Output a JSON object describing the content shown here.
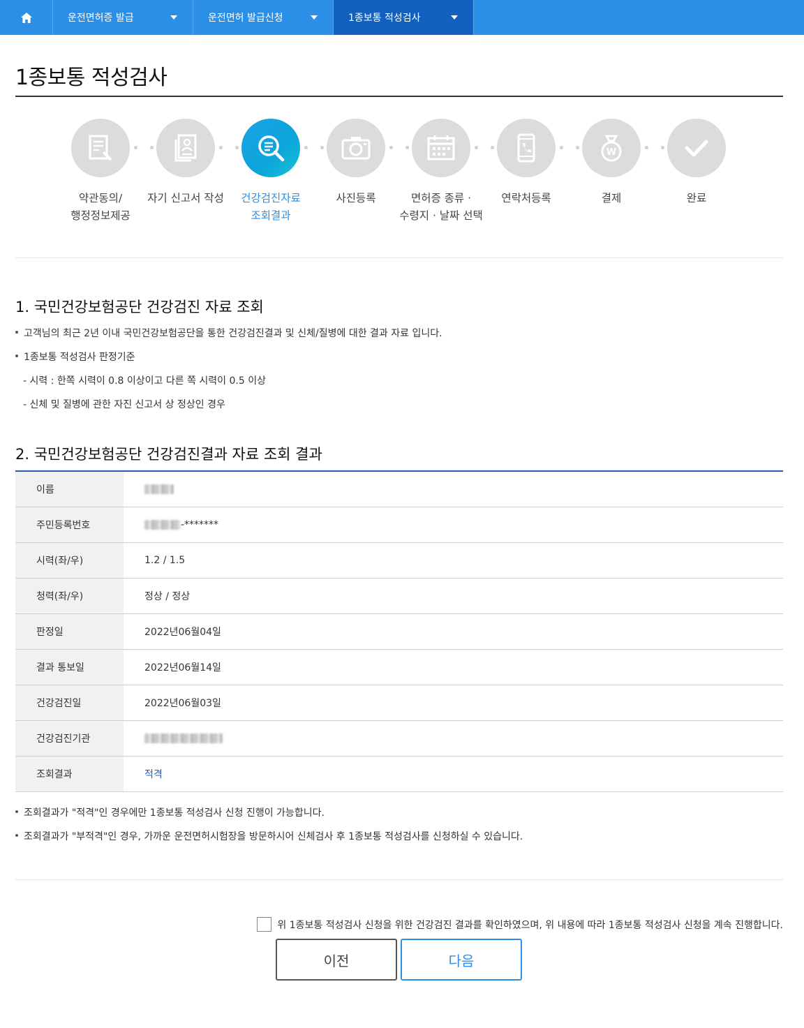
{
  "nav": {
    "items": [
      {
        "label": "운전면허증 발급"
      },
      {
        "label": "운전면허 발급신청"
      },
      {
        "label": "1종보통 적성검사"
      }
    ]
  },
  "page": {
    "title": "1종보통 적성검사"
  },
  "steps": [
    {
      "label": "약관동의/\n행정정보제공",
      "icon": "document-edit-icon"
    },
    {
      "label": "자기 신고서 작성",
      "icon": "self-report-icon"
    },
    {
      "label": "건강검진자료\n조회결과",
      "icon": "search-list-icon",
      "active": true
    },
    {
      "label": "사진등록",
      "icon": "camera-icon"
    },
    {
      "label": "면허증 종류 ·\n수령지 · 날짜 선택",
      "icon": "calendar-icon"
    },
    {
      "label": "연락처등록",
      "icon": "phone-icon"
    },
    {
      "label": "결제",
      "icon": "money-bag-icon"
    },
    {
      "label": "완료",
      "icon": "check-icon"
    }
  ],
  "section1": {
    "title": "1. 국민건강보험공단 건강검진 자료 조회",
    "bullet1": "고객님의 최근 2년 이내 국민건강보험공단을 통한 건강검진결과 및 신체/질병에 대한 결과 자료 입니다.",
    "bullet2": "1종보통 적성검사 판정기준",
    "sub1": "- 시력 : 한쪽 시력이 0.8 이상이고 다른 쪽 시력이 0.5 이상",
    "sub2": "- 신체 및 질병에 관한 자진 신고서 상 정상인 경우"
  },
  "section2": {
    "title": "2. 국민건강보험공단 건강검진결과 자료 조회 결과",
    "rows": [
      {
        "label": "이름",
        "value": ""
      },
      {
        "label": "주민등록번호",
        "value": "-*******"
      },
      {
        "label": "시력(좌/우)",
        "value": "1.2 / 1.5"
      },
      {
        "label": "청력(좌/우)",
        "value": "정상 / 정상"
      },
      {
        "label": "판정일",
        "value": "2022년06월04일"
      },
      {
        "label": "결과 통보일",
        "value": "2022년06월14일"
      },
      {
        "label": "건강검진일",
        "value": "2022년06월03일"
      },
      {
        "label": "건강검진기관",
        "value": ""
      },
      {
        "label": "조회결과",
        "value": "적격"
      }
    ],
    "note1": "조회결과가 \"적격\"인 경우에만 1종보통 적성검사 신청 진행이 가능합니다.",
    "note2": "조회결과가 \"부적격\"인 경우, 가까운 운전면허시험장을 방문하시어 신체검사 후 1종보통 적성검사를 신청하실 수 있습니다."
  },
  "agree": {
    "label": "위 1종보통 적성검사 신청을 위한 건강검진 결과를 확인하였으며, 위 내용에 따라 1종보통 적성검사 신청을 계속 진행합니다."
  },
  "buttons": {
    "prev": "이전",
    "next": "다음"
  },
  "colors": {
    "nav": "#2b8fe8",
    "nav_active": "#1261be",
    "accent": "#1e5fb4",
    "step_active": "#0ba5d8"
  }
}
